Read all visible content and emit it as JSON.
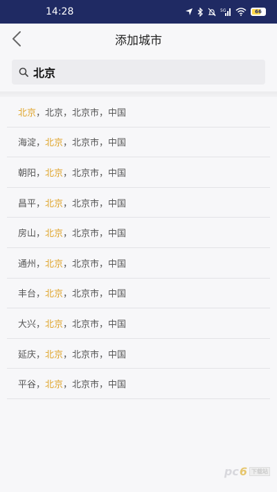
{
  "status_bar": {
    "time": "14:28",
    "network_label": "5G",
    "battery_label": "66"
  },
  "nav": {
    "title": "添加城市"
  },
  "search": {
    "value": "北京",
    "placeholder": ""
  },
  "results": [
    {
      "prefix": "",
      "highlight": "北京",
      "rest_lead": "，",
      "after": "北京，北京市，中国"
    },
    {
      "prefix": "海淀，",
      "highlight": "北京",
      "rest_lead": "，",
      "after": "北京市，中国"
    },
    {
      "prefix": "朝阳，",
      "highlight": "北京",
      "rest_lead": "，",
      "after": "北京市，中国"
    },
    {
      "prefix": "昌平，",
      "highlight": "北京",
      "rest_lead": "，",
      "after": "北京市，中国"
    },
    {
      "prefix": "房山，",
      "highlight": "北京",
      "rest_lead": "，",
      "after": "北京市，中国"
    },
    {
      "prefix": "通州，",
      "highlight": "北京",
      "rest_lead": "，",
      "after": "北京市，中国"
    },
    {
      "prefix": "丰台，",
      "highlight": "北京",
      "rest_lead": "，",
      "after": "北京市，中国"
    },
    {
      "prefix": "大兴，",
      "highlight": "北京",
      "rest_lead": "，",
      "after": "北京市，中国"
    },
    {
      "prefix": "延庆，",
      "highlight": "北京",
      "rest_lead": "，",
      "after": "北京市，中国"
    },
    {
      "prefix": "平谷，",
      "highlight": "北京",
      "rest_lead": "，",
      "after": "北京市，中国"
    }
  ],
  "watermark": {
    "text_a": "pc",
    "text_b": "6",
    "text_c": "下载站"
  },
  "colors": {
    "status_bar": "#1f2a63",
    "highlight": "#e0a62e",
    "background": "#f7f7f9"
  }
}
